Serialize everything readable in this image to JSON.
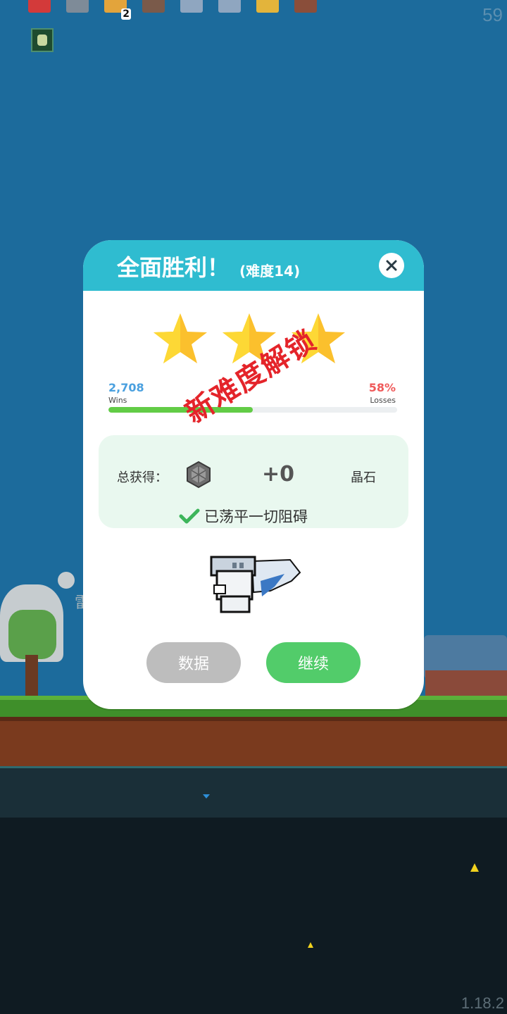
{
  "hud": {
    "fps": "59",
    "items": [
      {
        "icon": "shield-heart-icon",
        "color": "#d33a3a"
      },
      {
        "icon": "helmet-icon",
        "color": "#7e8b98"
      },
      {
        "icon": "drumstick-icon",
        "color": "#e3a43b",
        "count": "2"
      },
      {
        "icon": "round-bomb-icon",
        "color": "#7a5a4a"
      },
      {
        "icon": "wand-icon",
        "color": "#8fa6c0"
      },
      {
        "icon": "hook-icon",
        "color": "#8fa6c0"
      },
      {
        "icon": "battery-icon",
        "color": "#e3b43b"
      },
      {
        "icon": "chest-icon",
        "color": "#8a4e3a"
      }
    ]
  },
  "background": {
    "sign_text": "雷",
    "version": "1.18.2"
  },
  "modal": {
    "title": "全面胜利！",
    "difficulty": "(难度14)",
    "stars_earned": 3,
    "stars_total": 3,
    "wins_value": "2,708",
    "wins_label": "Wins",
    "losses_value": "58%",
    "losses_label": "Losses",
    "win_ratio": 0.5,
    "stamp": "新难度解锁",
    "reward_label": "总获得：",
    "reward_icon": "crystal-gem-icon",
    "reward_value": "+0",
    "reward_unit": "晶石",
    "cleared_text": "已荡平一切阻碍",
    "pet_icon": "winged-cat-pet-icon",
    "btn_stats": "数据",
    "btn_continue": "继续",
    "colors": {
      "header": "#2fbcd0",
      "star": "#fbc02d",
      "wins": "#4aa0df",
      "losses": "#ef5a5a",
      "bar_fill": "#62cc46",
      "continue": "#52cc6a",
      "stats": "#bdbdbd",
      "stamp": "#e4242a"
    }
  }
}
